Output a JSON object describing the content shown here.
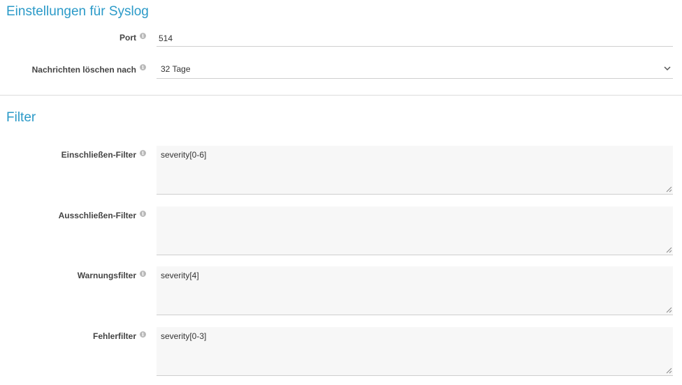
{
  "syslog": {
    "title": "Einstellungen für Syslog",
    "port_label": "Port",
    "port_value": "514",
    "delete_label": "Nachrichten löschen nach",
    "delete_value": "32 Tage"
  },
  "filter": {
    "title": "Filter",
    "include_label": "Einschließen-Filter",
    "include_value": "severity[0-6]",
    "exclude_label": "Ausschließen-Filter",
    "exclude_value": "",
    "warning_label": "Warnungsfilter",
    "warning_value": "severity[4]",
    "error_label": "Fehlerfilter",
    "error_value": "severity[0-3]"
  },
  "icons": {
    "info": "info-icon",
    "dropdown": "chevron-down-icon",
    "resize": "resize-handle-icon"
  },
  "colors": {
    "accent": "#2b9ac8",
    "label": "#444444",
    "divider": "#dcdcdc",
    "field_background": "#f7f7f7"
  }
}
